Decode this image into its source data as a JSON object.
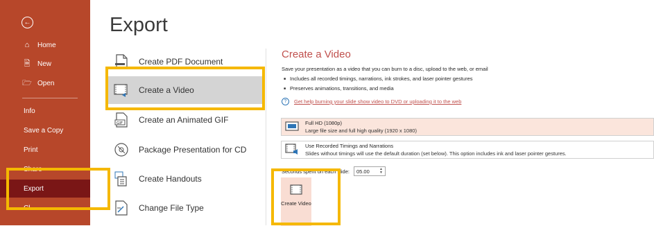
{
  "nav": {
    "back_icon": "back-arrow-icon",
    "items": [
      {
        "label": "Home",
        "icon": "home-icon"
      },
      {
        "label": "New",
        "icon": "new-file-icon"
      },
      {
        "label": "Open",
        "icon": "folder-icon"
      }
    ],
    "text_items": [
      {
        "label": "Info"
      },
      {
        "label": "Save a Copy"
      },
      {
        "label": "Print"
      },
      {
        "label": "Share"
      },
      {
        "label": "Export",
        "selected": true
      },
      {
        "label": "Cl"
      }
    ],
    "background": "#b7472a",
    "selected_background": "#7a1616"
  },
  "page_title": "Export",
  "options": [
    {
      "label": "Create PDF Document",
      "icon": "pdf-document-icon"
    },
    {
      "label": "Create a Video",
      "icon": "video-icon",
      "selected": true
    },
    {
      "label": "Create an Animated GIF",
      "icon": "gif-icon"
    },
    {
      "label": "Package Presentation for CD",
      "icon": "cd-icon"
    },
    {
      "label": "Create Handouts",
      "icon": "handouts-icon"
    },
    {
      "label": "Change File Type",
      "icon": "change-file-type-icon"
    }
  ],
  "pane": {
    "title": "Create a Video",
    "description": "Save your presentation as a video that you can burn to a disc, upload to the web, or email",
    "bullets": [
      "Includes all recorded timings, narrations, ink strokes, and laser pointer gestures",
      "Preserves animations, transitions, and media"
    ],
    "help_link": "Get help burning your slide show video to DVD or uploading it to the web",
    "resolution": {
      "title": "Full HD (1080p)",
      "subtitle": "Large file size and full high quality (1920 x 1080)"
    },
    "timings": {
      "title": "Use Recorded Timings and Narrations",
      "subtitle": "Slides without timings will use the default duration (set below). This option includes ink and laser pointer gestures."
    },
    "seconds_label": "Seconds spent on each slide:",
    "seconds_value": "05.00",
    "create_button": "Create Video"
  },
  "accent_color": "#c0504d",
  "highlight_color": "#f5b800"
}
